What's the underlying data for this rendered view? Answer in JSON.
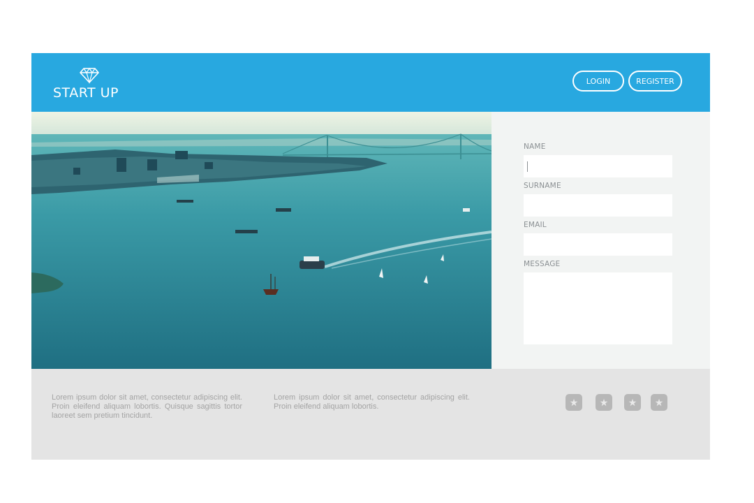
{
  "header": {
    "logo_text": "START UP",
    "logo_icon": "diamond-icon",
    "login_label": "LOGIN",
    "register_label": "REGISTER",
    "background_color": "#28a8e0"
  },
  "hero": {
    "image": "aerial-harbor-photo"
  },
  "form": {
    "fields": [
      {
        "label": "NAME",
        "value": ""
      },
      {
        "label": "SURNAME",
        "value": ""
      },
      {
        "label": "EMAIL",
        "value": ""
      },
      {
        "label": "MESSAGE",
        "value": ""
      }
    ]
  },
  "footer": {
    "text_1": "Lorem ipsum dolor sit amet, consectetur adipiscing elit. Proin eleifend aliquam lobortis. Quisque sagittis tortor laoreet sem pretium tincidunt.",
    "text_2": "Lorem ipsum dolor sit amet, consectetur adipiscing elit. Proin eleifend aliquam lobortis.",
    "social_icons": [
      "star-icon",
      "star-icon",
      "star-icon",
      "star-icon"
    ],
    "social_glyph": "★"
  }
}
